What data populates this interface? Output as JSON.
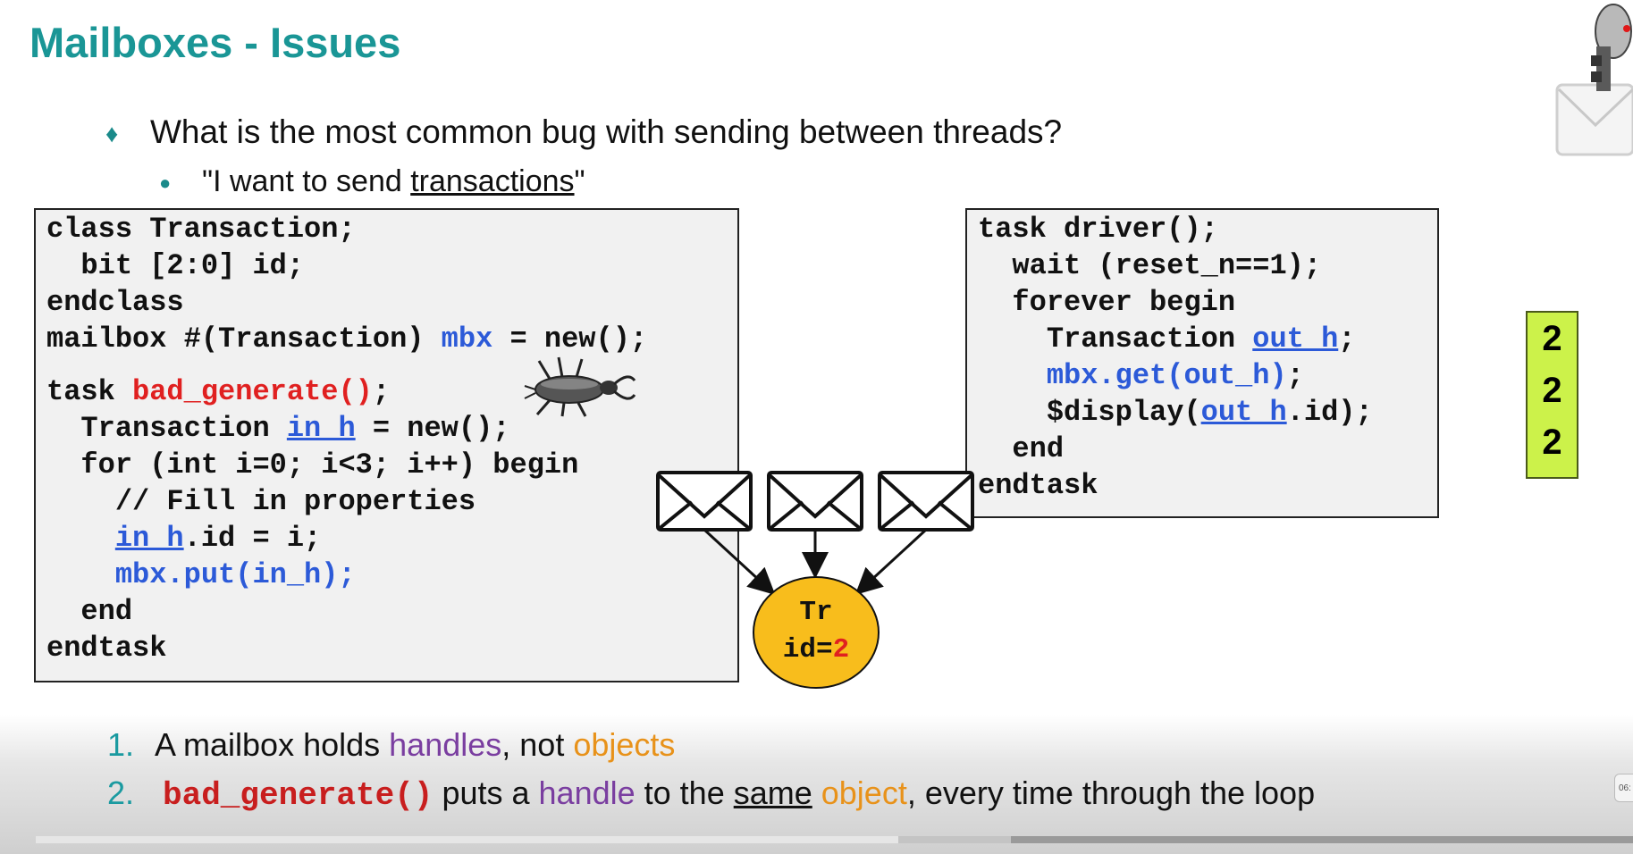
{
  "slide": {
    "title": "Mailboxes - Issues",
    "bullet1": "What is the most common bug with sending between threads?",
    "bullet2_pre": "\"I want to send ",
    "bullet2_link": "transactions",
    "bullet2_post": "\""
  },
  "code_left": {
    "l1": "class Transaction;",
    "l2": "  bit [2:0] id;",
    "l3": "endclass",
    "l4a": "mailbox #(Transaction) ",
    "l4b": "mbx",
    "l4c": " = new();",
    "l5a": "task ",
    "l5b": "bad_generate()",
    "l5c": ";",
    "l6a": "  Transaction ",
    "l6b": "in_h",
    "l6c": " = new();",
    "l7": "  for (int i=0; i<3; i++) begin",
    "l8": "    // Fill in properties",
    "l9a": "    ",
    "l9b": "in_h",
    "l9c": ".id = i;",
    "l10a": "    ",
    "l10b": "mbx.put(in_h);",
    "l11": "  end",
    "l12": "endtask"
  },
  "code_right": {
    "l1": "task driver();",
    "l2": "  wait (reset_n==1);",
    "l3": "  forever begin",
    "l4a": "    Transaction ",
    "l4b": "out_h",
    "l4c": ";",
    "l5a": "    ",
    "l5b": "mbx.get(out_h)",
    "l5c": ";",
    "l6a": "    $display(",
    "l6b": "out_h",
    "l6c": ".id);",
    "l7": "  end",
    "l8": "endtask"
  },
  "object": {
    "line1": "Tr",
    "line2_pre": "id=",
    "line2_val": "2"
  },
  "output": [
    "2",
    "2",
    "2"
  ],
  "points": {
    "n1": "1.",
    "p1_a": "A mailbox holds ",
    "p1_b": "handles",
    "p1_c": ", not ",
    "p1_d": "objects",
    "n2": "2.",
    "p2_a": "bad_generate()",
    "p2_b": " puts a ",
    "p2_c": "handle",
    "p2_d": " to the ",
    "p2_e": "same",
    "p2_f": " ",
    "p2_g": "object",
    "p2_h": ", every time through the loop"
  },
  "player": {
    "time": "06:",
    "progress": 0.54
  },
  "colors": {
    "title": "#1a9696",
    "keyword_blue": "#2c5ad8",
    "keyword_red": "#e02020",
    "handle_purple": "#7a3ea0",
    "object_orange": "#e8921a",
    "object_fill": "#f8bd1c",
    "counter_fill": "#ccf24a"
  },
  "icons": [
    "bug-icon",
    "envelope-icon",
    "robot-mail-icon"
  ]
}
